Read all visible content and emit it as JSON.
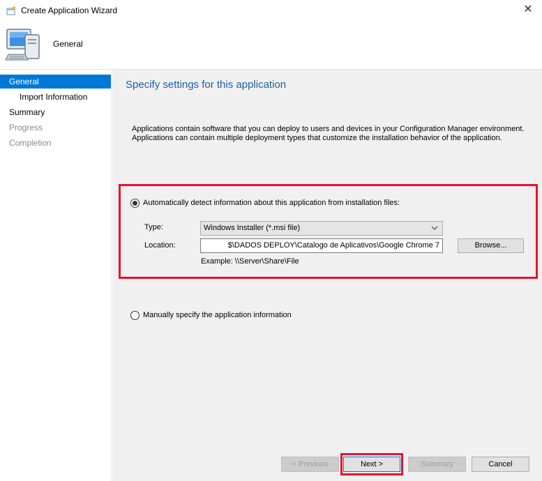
{
  "window": {
    "title": "Create Application Wizard",
    "close_glyph": "✕"
  },
  "header": {
    "title": "General"
  },
  "sidebar": {
    "items": [
      {
        "label": "General",
        "state": "active"
      },
      {
        "label": "Import Information",
        "state": "sub"
      },
      {
        "label": "Summary",
        "state": "normal"
      },
      {
        "label": "Progress",
        "state": "disabled"
      },
      {
        "label": "Completion",
        "state": "disabled"
      }
    ]
  },
  "main": {
    "title": "Specify settings for this application",
    "description_line1": "Applications contain software that you can deploy to users and devices in your Configuration Manager environment.",
    "description_line2": "Applications can contain multiple deployment types that customize the installation behavior of the application.",
    "auto_detect": {
      "label": "Automatically detect information about this application from installation files:",
      "checked": true
    },
    "type": {
      "label": "Type:",
      "value": "Windows Installer (*.msi file)"
    },
    "location": {
      "label": "Location:",
      "value": "$\\DADOS DEPLOY\\Catalogo de Aplicativos\\Google Chrome 7"
    },
    "browse_label": "Browse...",
    "example": "Example: \\\\Server\\Share\\File",
    "manual": {
      "label": "Manually specify the application information",
      "checked": false
    }
  },
  "footer": {
    "previous_label": "< Previous",
    "next_label": "Next >",
    "summary_label": "Summary",
    "cancel_label": "Cancel"
  },
  "colors": {
    "accent": "#0078d7",
    "highlight": "#e8112d",
    "title_blue": "#1f5f9e"
  }
}
